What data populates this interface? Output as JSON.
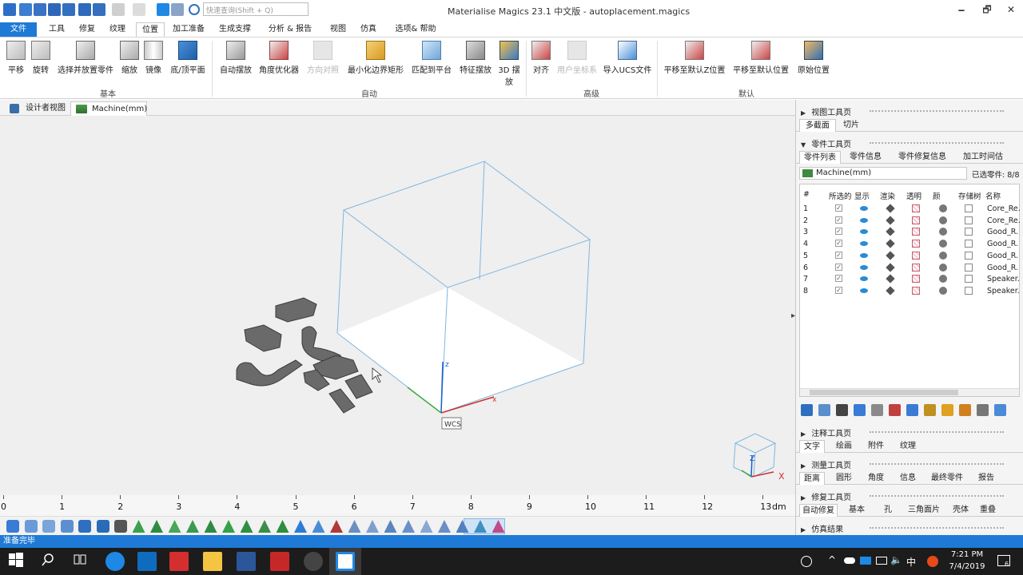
{
  "window": {
    "title": "Materialise Magics 23.1 中文版 - autoplacement.magics",
    "search_placeholder": "快速查询(Shift + Q)",
    "minimize": "🗕",
    "maximize": "🗗",
    "close": "✕"
  },
  "ribbon_tabs": [
    "文件",
    "工具",
    "修复",
    "纹理",
    "位置",
    "加工准备",
    "生成支撑",
    "分析 & 报告",
    "视图",
    "仿真",
    "选项& 帮助"
  ],
  "ribbon": {
    "basic": {
      "label": "基本",
      "buttons": [
        "平移",
        "旋转",
        "选择并放置零件",
        "缩放",
        "镜像",
        "底/顶平面"
      ]
    },
    "auto": {
      "label": "自动",
      "buttons": [
        "自动摆放",
        "角度优化器",
        "方向对照",
        "最小化边界矩形",
        "匹配到平台",
        "特征摆放",
        "3D 摆放"
      ]
    },
    "advanced": {
      "label": "高级",
      "buttons": [
        "对齐",
        "用户坐标系",
        "导入UCS文件"
      ]
    },
    "default": {
      "label": "默认",
      "buttons": [
        "平移至默认Z位置",
        "平移至默认位置",
        "原始位置"
      ]
    }
  },
  "doc_tabs": [
    "设计者视图",
    "Machine(mm)"
  ],
  "viewport": {
    "wcs_label": "WCS",
    "axis_x": "x",
    "axis_z": "z",
    "cube_z": "Z",
    "cube_x": "X"
  },
  "ruler": {
    "numbers": [
      "0",
      "1",
      "2",
      "3",
      "4",
      "5",
      "6",
      "7",
      "8",
      "9",
      "10",
      "11",
      "12",
      "13"
    ],
    "unit": "dm"
  },
  "status": "准备完毕",
  "right_panel": {
    "view_toolpage": "视图工具页",
    "view_tabs": [
      "多截面",
      "切片"
    ],
    "part_toolpage": "零件工具页",
    "part_tabs": [
      "零件列表",
      "零件信息",
      "零件修复信息",
      "加工时间估"
    ],
    "machine": "Machine(mm)",
    "selected": "已选零件: 8/8",
    "columns": [
      "#",
      "所选的",
      "显示",
      "渲染",
      "透明",
      "颜",
      "存储树",
      "名称"
    ],
    "parts": [
      {
        "n": "1",
        "name": "Core_Re."
      },
      {
        "n": "2",
        "name": "Core_Re."
      },
      {
        "n": "3",
        "name": "Good_R."
      },
      {
        "n": "4",
        "name": "Good_R."
      },
      {
        "n": "5",
        "name": "Good_R."
      },
      {
        "n": "6",
        "name": "Good_R."
      },
      {
        "n": "7",
        "name": "Speaker."
      },
      {
        "n": "8",
        "name": "Speaker."
      }
    ],
    "annot_toolpage": "注释工具页",
    "annot_tabs": [
      "文字",
      "绘画",
      "附件",
      "纹理"
    ],
    "measure_toolpage": "测量工具页",
    "measure_tabs": [
      "距离",
      "圆形",
      "角度",
      "信息",
      "最终零件",
      "报告"
    ],
    "fix_toolpage": "修复工具页",
    "fix_tabs": [
      "自动修复",
      "基本",
      "孔",
      "三角面片",
      "壳体",
      "重叠"
    ],
    "sim_results": "仿真结果"
  },
  "taskbar": {
    "time": "7:21 PM",
    "date": "7/4/2019",
    "ime": "中",
    "notif_count": "6"
  },
  "colors": {
    "accent": "#1e7ad6",
    "build_box": "#7fb6e0",
    "part_grey": "#6a6a6a"
  }
}
